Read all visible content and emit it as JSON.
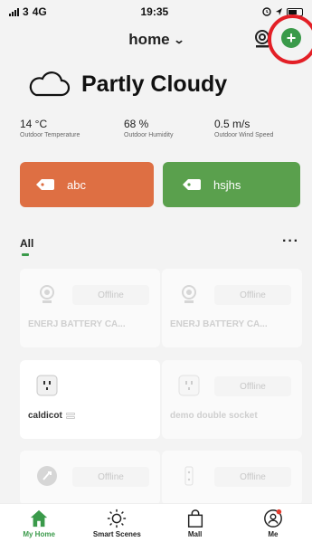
{
  "status_bar": {
    "signal": "3",
    "network": "4G",
    "time": "19:35"
  },
  "header": {
    "home_label": "home",
    "chevron": "⌄",
    "add_symbol": "+"
  },
  "weather": {
    "condition": "Partly Cloudy",
    "stats": [
      {
        "value": "14 °C",
        "label": "Outdoor Temperature"
      },
      {
        "value": "68 %",
        "label": "Outdoor Humidity"
      },
      {
        "value": "0.5 m/s",
        "label": "Outdoor Wind Speed"
      }
    ]
  },
  "scenes": [
    {
      "label": "abc",
      "color": "#de6f43"
    },
    {
      "label": "hsjhs",
      "color": "#5aa04d"
    }
  ],
  "tabs": {
    "all_label": "All",
    "more_symbol": "···"
  },
  "devices": [
    {
      "name": "ENERJ BATTERY CA...",
      "status": "Offline",
      "icon": "camera-icon"
    },
    {
      "name": "ENERJ BATTERY CA...",
      "status": "Offline",
      "icon": "camera-icon"
    },
    {
      "name": "caldicot",
      "status": "",
      "icon": "socket-icon"
    },
    {
      "name": "demo double socket",
      "status": "Offline",
      "icon": "socket-icon"
    },
    {
      "name": "",
      "status": "Offline",
      "icon": "sensor-icon"
    },
    {
      "name": "",
      "status": "Offline",
      "icon": "switch-icon"
    }
  ],
  "nav": {
    "items": [
      {
        "label": "My Home",
        "icon": "home-icon"
      },
      {
        "label": "Smart Scenes",
        "icon": "sun-icon"
      },
      {
        "label": "Mall",
        "icon": "bag-icon"
      },
      {
        "label": "Me",
        "icon": "profile-icon"
      }
    ]
  },
  "colors": {
    "accent": "#3a9a4a",
    "highlight": "#e31f26",
    "notification": "#e33b2e"
  }
}
